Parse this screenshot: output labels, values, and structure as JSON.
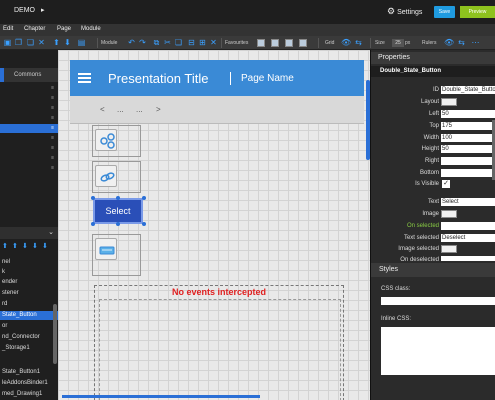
{
  "topbar": {
    "project": "DEMO",
    "project_arrow": "▸",
    "settings_icon": "⚙",
    "settings_label": "Settings",
    "save_label": "Save",
    "preview_label": "Preview"
  },
  "menu": [
    "Edit",
    "Chapter",
    "Page",
    "Module"
  ],
  "toolbar": {
    "module_label": "Module",
    "favourites_label": "Favourites",
    "grid_label": "Grid",
    "size_label": "Size",
    "size_value": "25",
    "size_unit": "px",
    "rulers_label": "Rulers"
  },
  "left_panel": {
    "commons_tab": "Commons",
    "page_count_marker": "≡",
    "modules_chevron": "⌄",
    "modules": [
      "nel",
      "k",
      "ender",
      "stener",
      "rd",
      "State_Button",
      "or",
      "nd_Connector",
      "_Storage1",
      "",
      "State_Button1",
      "leAddonsBinder1",
      "med_Drawing1"
    ]
  },
  "canvas": {
    "presentation_title": "Presentation Title",
    "page_name": "Page Name",
    "nav_prev": "<",
    "nav_dots1": "...",
    "nav_dots2": "...",
    "nav_next": ">",
    "select_button": "Select",
    "events_text": "No events intercepted"
  },
  "properties": {
    "header": "Properties",
    "module_name": "Double_State_Button",
    "id_label": "ID",
    "id_value": "Double_State_Button",
    "layout_label": "Layout",
    "left_label": "Left",
    "left_value": "50",
    "top_label": "Top",
    "top_value": "175",
    "width_label": "Width",
    "width_value": "100",
    "height_label": "Height",
    "height_value": "50",
    "right_label": "Right",
    "right_value": "",
    "bottom_label": "Bottom",
    "bottom_value": "",
    "visible_label": "Is Visible",
    "visible_check": "✓",
    "text_label": "Text",
    "text_value": "Select",
    "image_label": "Image",
    "on_selected_label": "On selected",
    "text_selected_label": "Text selected",
    "text_selected_value": "Deselect",
    "image_selected_label": "Image selected",
    "on_deselected_label": "On deselected"
  },
  "styles": {
    "header": "Styles",
    "css_class_label": "CSS class:",
    "inline_css_label": "Inline CSS:"
  }
}
